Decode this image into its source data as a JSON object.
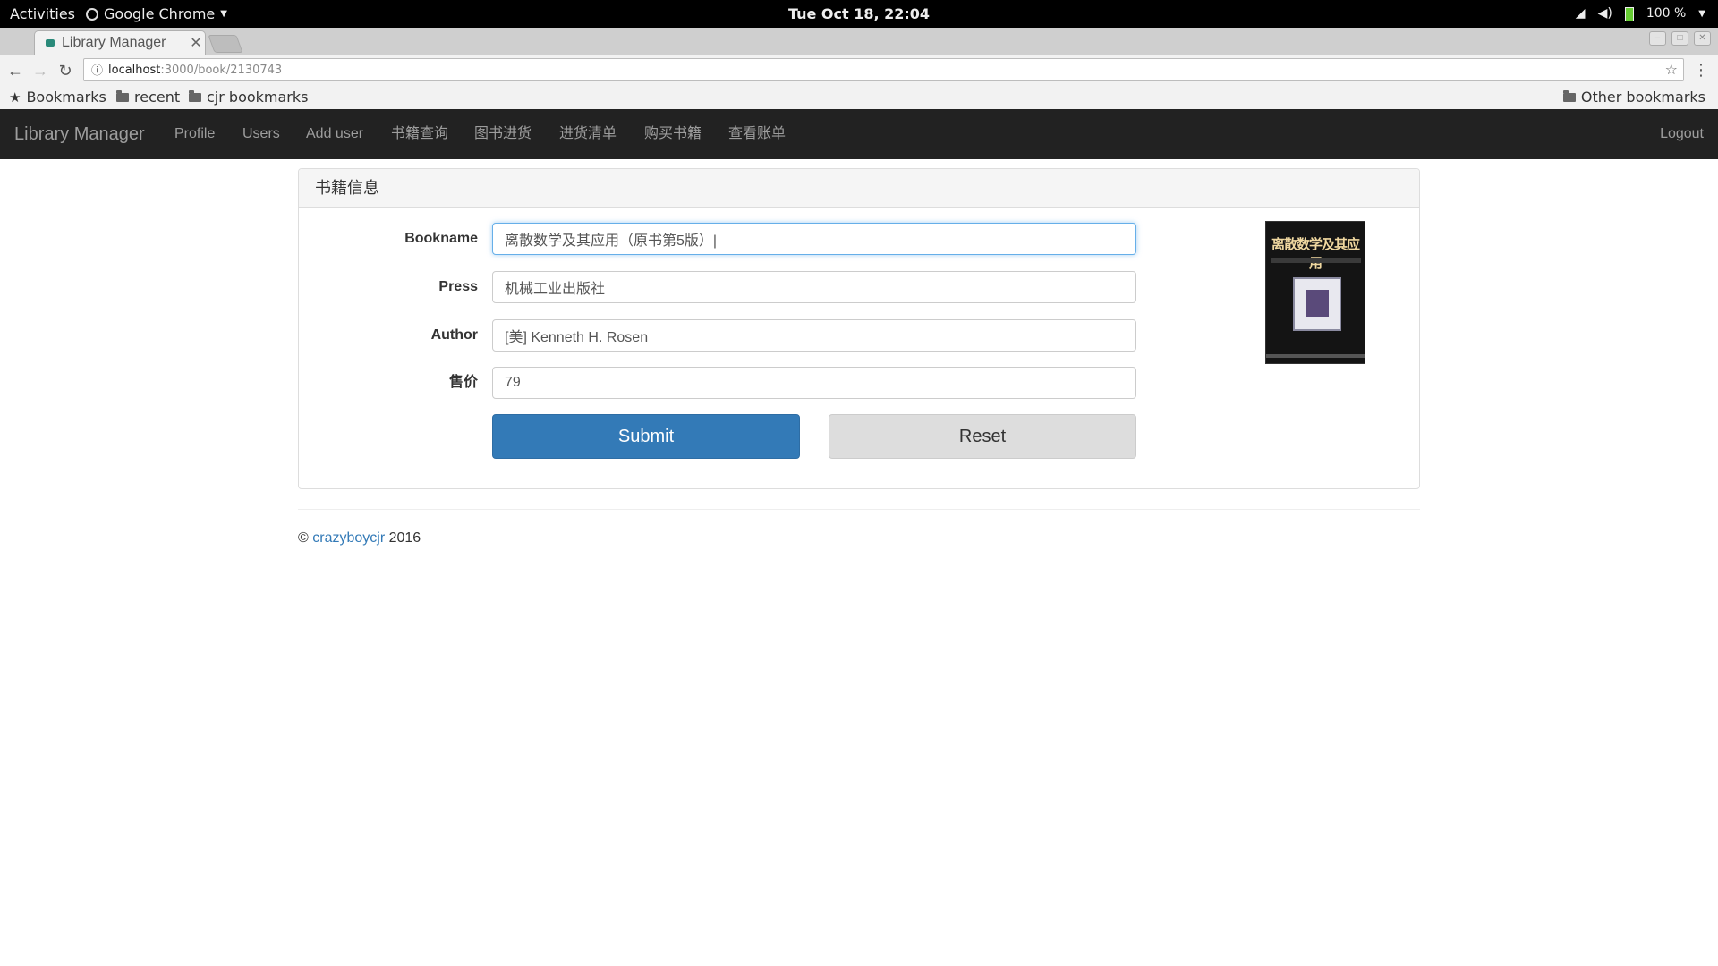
{
  "system_bar": {
    "activities": "Activities",
    "app_name": "Google Chrome",
    "clock": "Tue Oct 18, 22:04",
    "battery": "100 %"
  },
  "browser": {
    "tab_title": "Library Manager",
    "url_host": "localhost",
    "url_path": ":3000/book/2130743",
    "bookmarks": [
      "Bookmarks",
      "recent",
      "cjr bookmarks"
    ],
    "other_bookmarks": "Other bookmarks"
  },
  "navbar": {
    "brand": "Library Manager",
    "links": [
      "Profile",
      "Users",
      "Add user",
      "书籍查询",
      "图书进货",
      "进货清单",
      "购买书籍",
      "查看账单"
    ],
    "logout": "Logout"
  },
  "panel": {
    "heading": "书籍信息",
    "fields": [
      {
        "label": "Bookname",
        "value": "离散数学及其应用（原书第5版）|"
      },
      {
        "label": "Press",
        "value": "机械工业出版社"
      },
      {
        "label": "Author",
        "value": "[美] Kenneth H. Rosen"
      },
      {
        "label": "售价",
        "value": "79"
      }
    ],
    "submit_label": "Submit",
    "reset_label": "Reset",
    "cover_title": "离散数学及其应用"
  },
  "footer": {
    "copyright": "©",
    "author_link": "crazyboycjr",
    "year": "2016"
  },
  "colors": {
    "navbar_bg": "#222222",
    "primary": "#337ab7",
    "focus_border": "#66afe9"
  },
  "icons": [
    "chrome-icon",
    "dropdown-icon",
    "wifi-icon",
    "volume-icon",
    "battery-icon",
    "back-icon",
    "forward-icon",
    "reload-icon",
    "info-icon",
    "star-icon",
    "menu-icon",
    "folder-icon"
  ]
}
